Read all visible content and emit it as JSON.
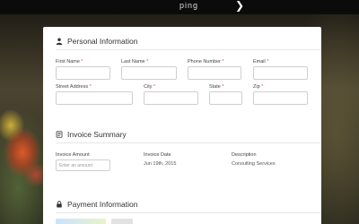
{
  "header": {
    "nav_fragment": "ping",
    "chevron_glyph": "❯"
  },
  "personal": {
    "title": "Personal Information",
    "first_name_label": "First Name",
    "last_name_label": "Last Name",
    "phone_label": "Phone Number",
    "email_label": "Email",
    "street_label": "Street Address",
    "city_label": "City",
    "state_label": "State",
    "zip_label": "Zip",
    "required_mark": "*"
  },
  "invoice": {
    "title": "Invoice Summary",
    "amount_label": "Invoice Amount",
    "amount_placeholder": "Enter an amount",
    "date_label": "Invoice Date",
    "date_value": "Jun 19th, 2015",
    "description_label": "Description",
    "description_value": "Consulting Services"
  },
  "payment": {
    "title": "Payment Information"
  },
  "colors": {
    "required": "#d9534f",
    "card": "#ffffff"
  }
}
